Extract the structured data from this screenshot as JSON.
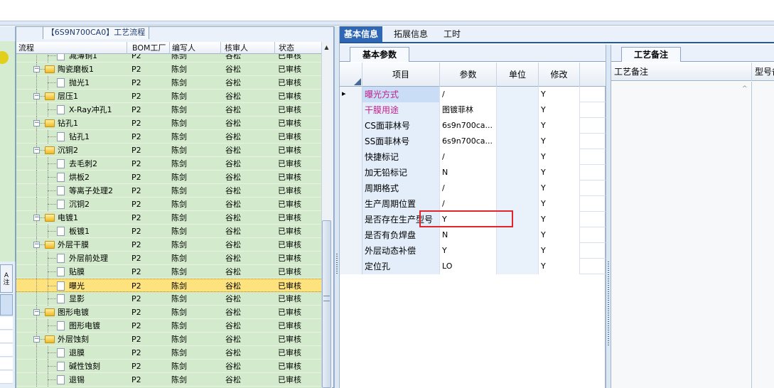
{
  "tree": {
    "tab_title": "【6S9N700CA0】工艺流程",
    "columns": [
      "流程",
      "BOM工厂",
      "编写人",
      "核审人",
      "状态"
    ],
    "rows": [
      {
        "name": "减薄铜1",
        "level": 2,
        "type": "doc",
        "bom": "P2",
        "writer": "陈剑",
        "checker": "谷松",
        "status": "已审核"
      },
      {
        "name": "陶瓷磨板1",
        "level": 1,
        "type": "folder",
        "bom": "P2",
        "writer": "陈剑",
        "checker": "谷松",
        "status": "已审核"
      },
      {
        "name": "抛光1",
        "level": 2,
        "type": "doc",
        "bom": "P2",
        "writer": "陈剑",
        "checker": "谷松",
        "status": "已审核"
      },
      {
        "name": "层压1",
        "level": 1,
        "type": "folder",
        "bom": "P2",
        "writer": "陈剑",
        "checker": "谷松",
        "status": "已审核"
      },
      {
        "name": "X-Ray冲孔1",
        "level": 2,
        "type": "doc",
        "bom": "P2",
        "writer": "陈剑",
        "checker": "谷松",
        "status": "已审核"
      },
      {
        "name": "钻孔1",
        "level": 1,
        "type": "folder",
        "bom": "P2",
        "writer": "陈剑",
        "checker": "谷松",
        "status": "已审核"
      },
      {
        "name": "钻孔1",
        "level": 2,
        "type": "doc",
        "bom": "P2",
        "writer": "陈剑",
        "checker": "谷松",
        "status": "已审核"
      },
      {
        "name": "沉铜2",
        "level": 1,
        "type": "folder",
        "bom": "P2",
        "writer": "陈剑",
        "checker": "谷松",
        "status": "已审核"
      },
      {
        "name": "去毛刺2",
        "level": 2,
        "type": "doc",
        "bom": "P2",
        "writer": "陈剑",
        "checker": "谷松",
        "status": "已审核"
      },
      {
        "name": "烘板2",
        "level": 2,
        "type": "doc",
        "bom": "P2",
        "writer": "陈剑",
        "checker": "谷松",
        "status": "已审核"
      },
      {
        "name": "等离子处理2",
        "level": 2,
        "type": "doc",
        "bom": "P2",
        "writer": "陈剑",
        "checker": "谷松",
        "status": "已审核"
      },
      {
        "name": "沉铜2",
        "level": 2,
        "type": "doc",
        "bom": "P2",
        "writer": "陈剑",
        "checker": "谷松",
        "status": "已审核"
      },
      {
        "name": "电镀1",
        "level": 1,
        "type": "folder",
        "bom": "P2",
        "writer": "陈剑",
        "checker": "谷松",
        "status": "已审核"
      },
      {
        "name": "板镀1",
        "level": 2,
        "type": "doc",
        "bom": "P2",
        "writer": "陈剑",
        "checker": "谷松",
        "status": "已审核"
      },
      {
        "name": "外层干膜",
        "level": 1,
        "type": "folder",
        "bom": "P2",
        "writer": "陈剑",
        "checker": "谷松",
        "status": "已审核"
      },
      {
        "name": "外层前处理",
        "level": 2,
        "type": "doc",
        "bom": "P2",
        "writer": "陈剑",
        "checker": "谷松",
        "status": "已审核"
      },
      {
        "name": "贴膜",
        "level": 2,
        "type": "doc",
        "bom": "P2",
        "writer": "陈剑",
        "checker": "谷松",
        "status": "已审核"
      },
      {
        "name": "曝光",
        "level": 2,
        "type": "doc",
        "bom": "P2",
        "writer": "陈剑",
        "checker": "谷松",
        "status": "已审核",
        "selected": true
      },
      {
        "name": "显影",
        "level": 2,
        "type": "doc",
        "bom": "P2",
        "writer": "陈剑",
        "checker": "谷松",
        "status": "已审核"
      },
      {
        "name": "图形电镀",
        "level": 1,
        "type": "folder",
        "bom": "P2",
        "writer": "陈剑",
        "checker": "谷松",
        "status": "已审核"
      },
      {
        "name": "图形电镀",
        "level": 2,
        "type": "doc",
        "bom": "P2",
        "writer": "陈剑",
        "checker": "谷松",
        "status": "已审核"
      },
      {
        "name": "外层蚀刻",
        "level": 1,
        "type": "folder",
        "bom": "P2",
        "writer": "陈剑",
        "checker": "谷松",
        "status": "已审核"
      },
      {
        "name": "退膜",
        "level": 2,
        "type": "doc",
        "bom": "P2",
        "writer": "陈剑",
        "checker": "谷松",
        "status": "已审核"
      },
      {
        "name": "碱性蚀刻",
        "level": 2,
        "type": "doc",
        "bom": "P2",
        "writer": "陈剑",
        "checker": "谷松",
        "status": "已审核"
      },
      {
        "name": "退锡",
        "level": 2,
        "type": "doc",
        "bom": "P2",
        "writer": "陈剑",
        "checker": "谷松",
        "status": "已审核"
      }
    ]
  },
  "main_tabs": [
    "基本信息",
    "拓展信息",
    "工时"
  ],
  "sub_tab": "基本参数",
  "grid": {
    "columns": [
      "项目",
      "参数",
      "单位",
      "修改"
    ],
    "rows": [
      {
        "item": "曝光方式",
        "param": "/",
        "unit": "",
        "mod": "Y",
        "color": "#c0208a",
        "current": true
      },
      {
        "item": "干膜用途",
        "param": "图镀菲林",
        "unit": "",
        "mod": "Y",
        "color": "#c0208a"
      },
      {
        "item": "CS面菲林号",
        "param": "6s9n700ca...",
        "unit": "",
        "mod": "Y"
      },
      {
        "item": "SS面菲林号",
        "param": "6s9n700ca...",
        "unit": "",
        "mod": "Y"
      },
      {
        "item": "快捷标记",
        "param": "/",
        "unit": "",
        "mod": "Y"
      },
      {
        "item": "加无铅标记",
        "param": "N",
        "unit": "",
        "mod": "Y"
      },
      {
        "item": "周期格式",
        "param": "/",
        "unit": "",
        "mod": "Y"
      },
      {
        "item": "生产周期位置",
        "param": "/",
        "unit": "",
        "mod": "Y"
      },
      {
        "item": "是否存在生产型号",
        "param": "Y",
        "unit": "",
        "mod": "Y"
      },
      {
        "item": "是否有负焊盘",
        "param": "N",
        "unit": "",
        "mod": "Y"
      },
      {
        "item": "外层动态补偿",
        "param": "Y",
        "unit": "",
        "mod": "Y"
      },
      {
        "item": "定位孔",
        "param": "LO",
        "unit": "",
        "mod": "Y"
      }
    ]
  },
  "notes": {
    "tab": "工艺备注",
    "col1": "工艺备注",
    "col2": "型号备"
  },
  "left_stub": {
    "tab_label": "A\n注"
  }
}
